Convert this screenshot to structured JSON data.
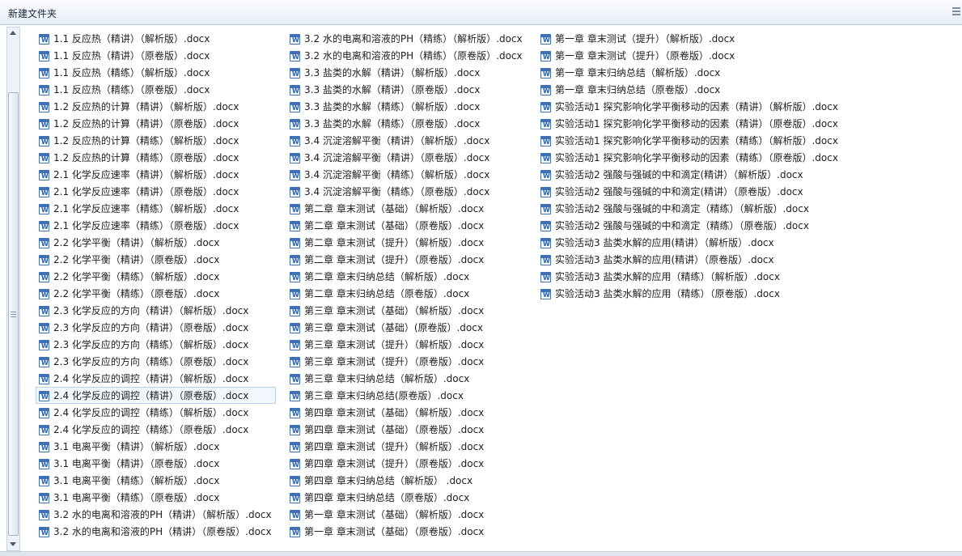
{
  "window": {
    "title": "新建文件夹"
  },
  "files": {
    "col1": [
      "1.1 反应热（精讲）（解析版）.docx",
      "1.1 反应热（精讲）（原卷版）.docx",
      "1.1 反应热（精练）（解析版）.docx",
      "1.1 反应热（精练）（原卷版）.docx",
      "1.2 反应热的计算（精讲）（解析版）.docx",
      "1.2 反应热的计算（精讲）（原卷版）.docx",
      "1.2 反应热的计算（精练）（解析版）.docx",
      "1.2 反应热的计算（精练）（原卷版）.docx",
      "2.1 化学反应速率（精讲）（解析版）.docx",
      "2.1 化学反应速率（精讲）（原卷版）.docx",
      "2.1 化学反应速率（精练）（解析版）.docx",
      "2.1 化学反应速率（精练）（原卷版）.docx",
      "2.2 化学平衡（精讲）（解析版）.docx",
      "2.2 化学平衡（精讲）（原卷版）.docx",
      "2.2 化学平衡（精练）（解析版）.docx",
      "2.2 化学平衡（精练）（原卷版）.docx",
      "2.3 化学反应的方向（精讲）（解析版）.docx",
      "2.3 化学反应的方向（精讲）（原卷版）.docx",
      "2.3 化学反应的方向（精练）（解析版）.docx",
      "2.3 化学反应的方向（精练）（原卷版）.docx",
      "2.4 化学反应的调控（精讲）（解析版）.docx",
      "2.4 化学反应的调控（精讲）（原卷版）.docx",
      "2.4 化学反应的调控（精练）（解析版）.docx",
      "2.4 化学反应的调控（精练）（原卷版）.docx",
      "3.1 电离平衡（精讲）（解析版）.docx",
      "3.1 电离平衡（精讲）（原卷版）.docx",
      "3.1 电离平衡（精练）（解析版）.docx",
      "3.1 电离平衡（精练）（原卷版）.docx",
      "3.2 水的电离和溶液的PH（精讲）（解析版）.docx",
      "3.2 水的电离和溶液的PH（精讲）（原卷版）.docx"
    ],
    "col2": [
      "3.2 水的电离和溶液的PH（精练）（解析版）.docx",
      "3.2 水的电离和溶液的PH（精练）（原卷版）.docx",
      "3.3 盐类的水解（精讲）（解析版）.docx",
      "3.3 盐类的水解（精讲）（原卷版）.docx",
      "3.3 盐类的水解（精练）（解析版）.docx",
      "3.3 盐类的水解（精练）（原卷版）.docx",
      "3.4 沉淀溶解平衡（精讲）（解析版）.docx",
      "3.4 沉淀溶解平衡（精讲）（原卷版）.docx",
      "3.4 沉淀溶解平衡（精练）（解析版）.docx",
      "3.4 沉淀溶解平衡（精练）（原卷版）.docx",
      "第二章 章末测试（基础）（解析版）.docx",
      "第二章 章末测试（基础）（原卷版）.docx",
      "第二章 章末测试（提升）（解析版）.docx",
      "第二章 章末测试（提升）（原卷版）.docx",
      "第二章 章末归纳总结（解析版）.docx",
      "第二章 章末归纳总结（原卷版）.docx",
      "第三章 章末测试（基础）（解析版）.docx",
      "第三章 章末测试（基础）(原卷版）.docx",
      "第三章 章末测试（提升）（解析版）.docx",
      "第三章 章末测试（提升）（原卷版）.docx",
      "第三章 章末归纳总结（解析版）.docx",
      "第三章 章末归纳总结(原卷版）.docx",
      "第四章 章末测试（基础）（解析版）.docx",
      "第四章 章末测试（基础）（原卷版）.docx",
      "第四章 章末测试（提升）（解析版）.docx",
      "第四章 章末测试（提升）（原卷版）.docx",
      "第四章 章末归纳总结（解析版） .docx",
      "第四章 章末归纳总结（原卷版）.docx",
      "第一章 章末测试（基础）（解析版）.docx",
      "第一章 章末测试（基础）（原卷版）.docx"
    ],
    "col3": [
      "第一章 章末测试（提升）（解析版）.docx",
      "第一章 章末测试（提升）（原卷版）.docx",
      "第一章 章末归纳总结（解析版）.docx",
      "第一章 章末归纳总结（原卷版）.docx",
      "实验活动1 探究影响化学平衡移动的因素（精讲）（解析版）.docx",
      "实验活动1 探究影响化学平衡移动的因素（精讲）（原卷版）.docx",
      "实验活动1 探究影响化学平衡移动的因素（精练）（解析版）.docx",
      "实验活动1 探究影响化学平衡移动的因素（精练）（原卷版）.docx",
      "实验活动2  强酸与强碱的中和滴定(精讲）（解析版）.docx",
      "实验活动2  强酸与强碱的中和滴定(精讲）（原卷版）.docx",
      "实验活动2  强酸与强碱的中和滴定（精练）（解析版）.docx",
      "实验活动2  强酸与强碱的中和滴定（精练）（原卷版）.docx",
      "实验活动3  盐类水解的应用(精讲）（解析版）.docx",
      "实验活动3  盐类水解的应用(精讲）（原卷版）.docx",
      "实验活动3  盐类水解的应用（精练）（解析版）.docx",
      "实验活动3  盐类水解的应用（精练）（原卷版）.docx"
    ],
    "icon": "word-doc-icon",
    "icon_letter": "W",
    "selected": "2.4 化学反应的调控（精讲）（原卷版）.docx"
  },
  "colors": {
    "selection_bg": "#f2f7fd",
    "selection_border": "#b7d2ee",
    "icon_blue": "#3f6fb5"
  }
}
